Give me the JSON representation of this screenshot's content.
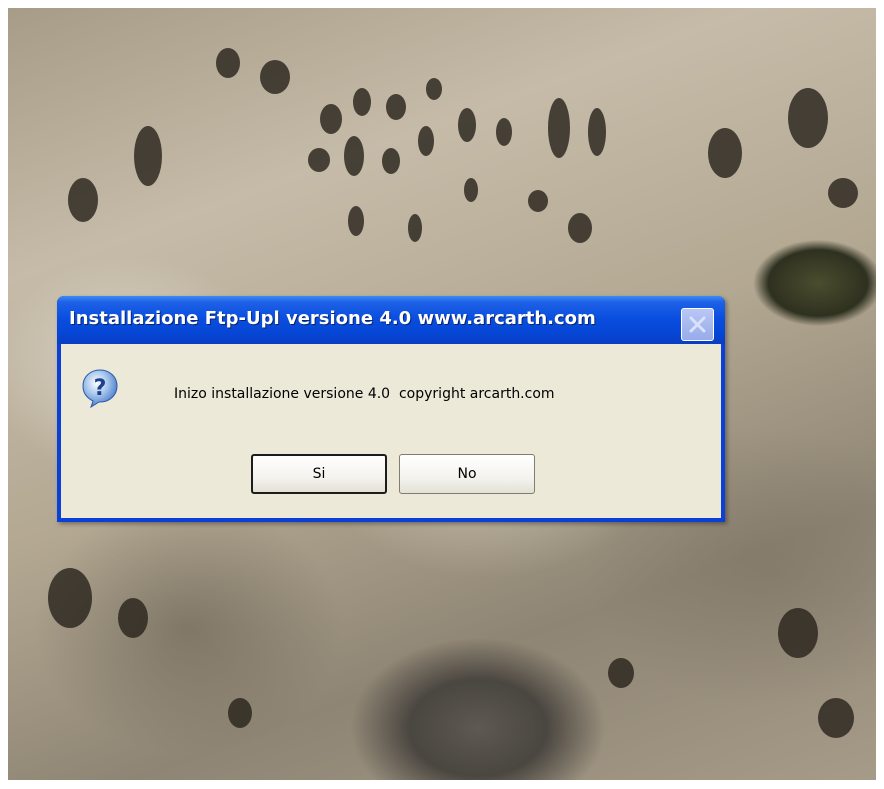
{
  "dialog": {
    "title": "Installazione Ftp-Upl versione 4.0  www.arcarth.com",
    "message": "Inizo installazione versione 4.0  copyright arcarth.com",
    "yes_label": "Si",
    "no_label": "No"
  },
  "colors": {
    "title_bar": "#0a4fe0",
    "dialog_body": "#ece9d8",
    "close_button": "#98abea"
  },
  "icons": {
    "dialog": "question-icon",
    "close": "close-icon"
  }
}
